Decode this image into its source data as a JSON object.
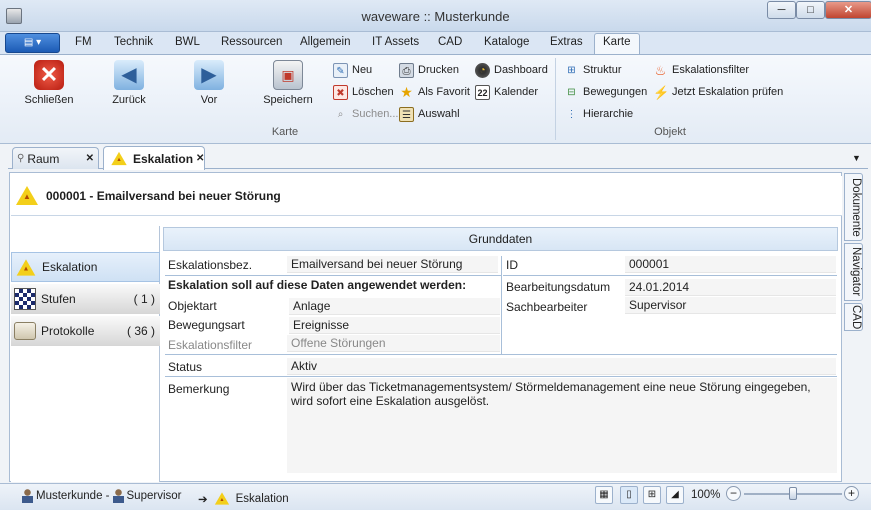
{
  "window": {
    "title": "waveware :: Musterkunde",
    "minimize_glyph": "─",
    "maximize_glyph": "□",
    "close_glyph": "✕"
  },
  "menu_tabs": [
    "FM",
    "Technik",
    "BWL",
    "Ressourcen",
    "Allgemein",
    "IT Assets",
    "CAD",
    "Kataloge",
    "Extras",
    "Karte"
  ],
  "ribbon": {
    "karte": {
      "close": "Schließen",
      "back": "Zurück",
      "forward": "Vor",
      "save": "Speichern",
      "new": "Neu",
      "delete": "Löschen",
      "search": "Suchen...",
      "print": "Drucken",
      "favorite": "Als Favorit",
      "choose": "Auswahl",
      "dashboard": "Dashboard",
      "calendar": "Kalender",
      "calendar_num": "22",
      "group_label": "Karte"
    },
    "objekt": {
      "structure": "Struktur",
      "movements": "Bewegungen",
      "hierarchy": "Hierarchie",
      "escalation_filter": "Eskalationsfilter",
      "check_escalation": "Jetzt Eskalation prüfen",
      "group_label": "Objekt"
    }
  },
  "doc_tabs": [
    {
      "label": "Raum",
      "close": "✕"
    },
    {
      "label": "Eskalation",
      "close": "✕"
    }
  ],
  "doc_dropdown_glyph": "▼",
  "header": {
    "title": "000001 - Emailversand bei neuer Störung"
  },
  "nav": [
    {
      "label": "Eskalation",
      "count": ""
    },
    {
      "label": "Stufen",
      "count": "( 1 )"
    },
    {
      "label": "Protokolle",
      "count": "( 36 )"
    }
  ],
  "side_tabs": [
    "Dokumente",
    "Navigator",
    "CAD"
  ],
  "form": {
    "section_title": "Grunddaten",
    "escalation_name_label": "Eskalationsbez.",
    "escalation_name_value": "Emailversand bei neuer Störung",
    "apply_heading": "Eskalation soll auf diese Daten angewendet werden:",
    "object_type_label": "Objektart",
    "object_type_value": "Anlage",
    "movement_type_label": "Bewegungsart",
    "movement_type_value": "Ereignisse",
    "escalation_filter_label": "Eskalationsfilter",
    "escalation_filter_value": "Offene Störungen",
    "status_label": "Status",
    "status_value": "Aktiv",
    "remark_label": "Bemerkung",
    "remark_value": "Wird über das Ticketmanagementsystem/ Störmeldemanagement eine neue Störung eingegeben, wird sofort eine Eskalation ausgelöst.",
    "id_label": "ID",
    "id_value": "000001",
    "edit_date_label": "Bearbeitungsdatum",
    "edit_date_value": "24.01.2014",
    "clerk_label": "Sachbearbeiter",
    "clerk_value": "Supervisor"
  },
  "statusbar": {
    "customer": "Musterkunde -",
    "user": "Supervisor",
    "arrow": "➔",
    "location": "Eskalation",
    "zoom": "100%",
    "zoom_level": 0.5,
    "zoom_minus": "−",
    "zoom_plus": "+"
  }
}
